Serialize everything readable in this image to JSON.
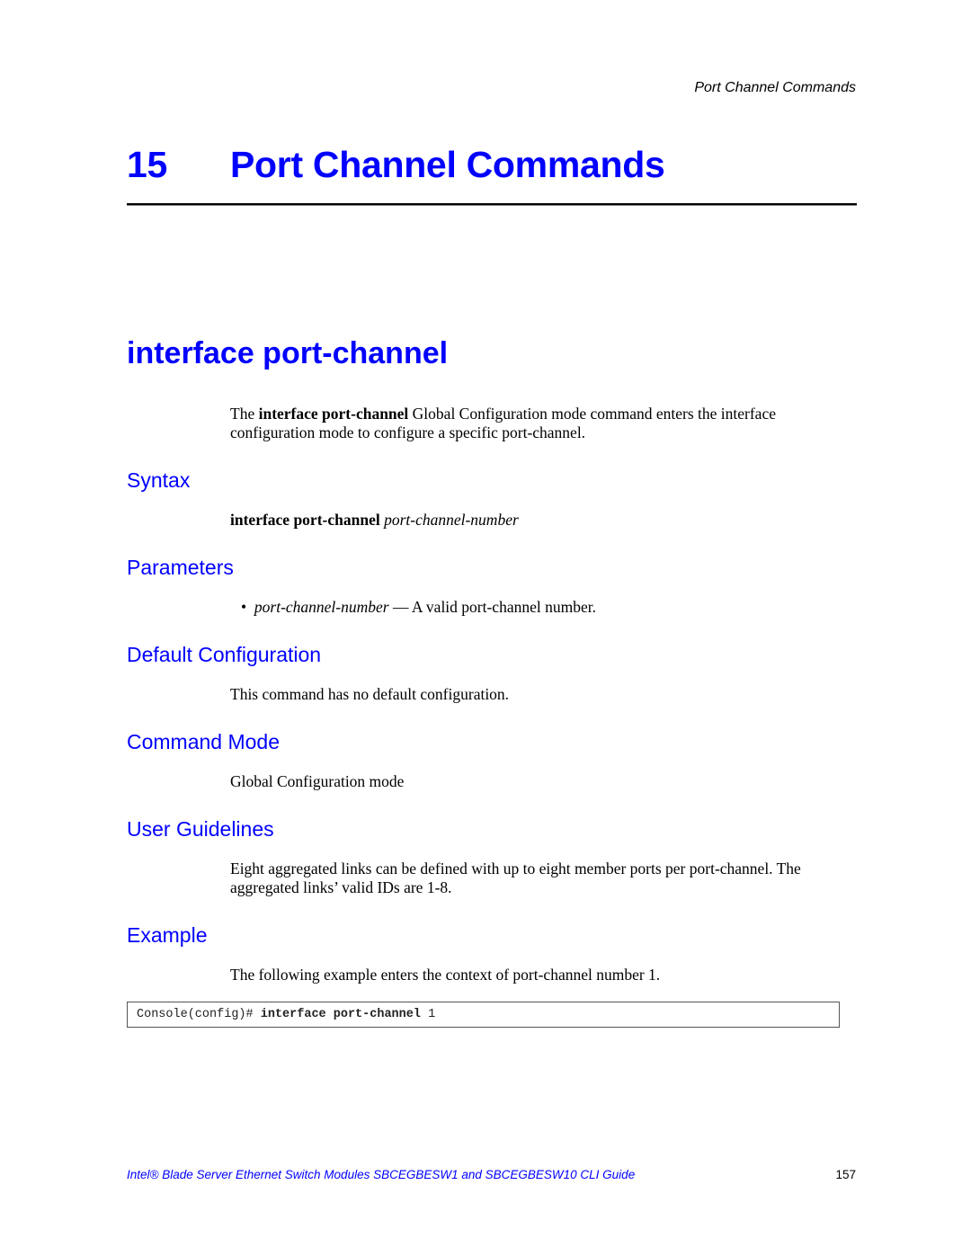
{
  "running_header": "Port Channel Commands",
  "chapter": {
    "number": "15",
    "title": "Port Channel Commands"
  },
  "section": {
    "title": "interface port-channel",
    "intro": {
      "prefix": "The ",
      "bold": "interface port-channel",
      "suffix": " Global Configuration mode command enters the interface configuration mode to configure a specific port-channel."
    }
  },
  "syntax": {
    "heading": "Syntax",
    "command_bold": "interface port-channel",
    "command_italic": "port-channel-number"
  },
  "parameters": {
    "heading": "Parameters",
    "items": [
      {
        "bullet": "•",
        "name": "port-channel-number",
        "description": " — A valid port-channel number."
      }
    ]
  },
  "default_configuration": {
    "heading": "Default Configuration",
    "text": "This command has no default configuration."
  },
  "command_mode": {
    "heading": "Command Mode",
    "text": "Global Configuration mode"
  },
  "user_guidelines": {
    "heading": "User Guidelines",
    "text": "Eight aggregated links can be defined with up to eight member ports per port-channel. The aggregated links’ valid IDs are 1-8."
  },
  "example": {
    "heading": "Example",
    "text": "The following example enters the context of port-channel number 1.",
    "code": {
      "prompt": "Console(config)# ",
      "command_bold": "interface port-channel",
      "argument": " 1"
    }
  },
  "footer": {
    "guide_title": "Intel® Blade Server Ethernet Switch Modules SBCEGBESW1 and SBCEGBESW10 CLI Guide",
    "page_number": "157"
  },
  "colors": {
    "heading_blue": "#0000ff",
    "text": "#000000"
  }
}
